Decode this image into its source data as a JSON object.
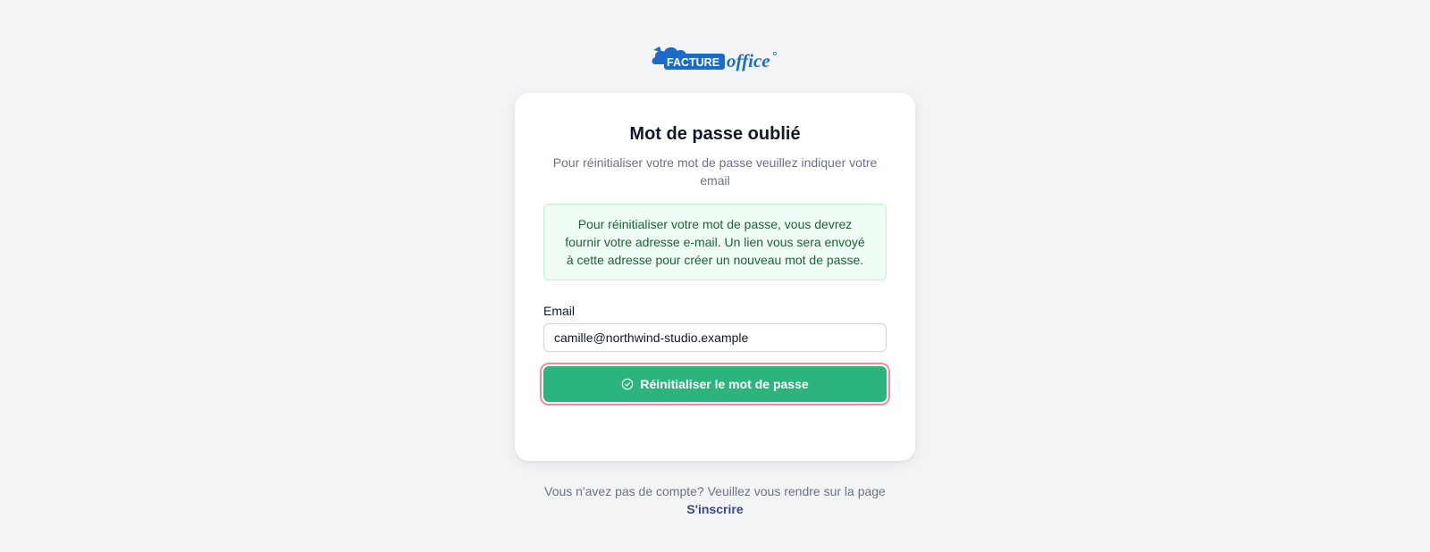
{
  "brand": {
    "logo_icon": "cloud-logo-icon",
    "wordmark_box": "FACTURE",
    "wordmark_script": "office",
    "primary_color": "#1a6cc8"
  },
  "form": {
    "title": "Mot de passe oublié",
    "subtitle": "Pour réinitialiser votre mot de passe veuillez indiquer votre email",
    "info_message": "Pour réinitialiser votre mot de passe, vous devrez fournir votre adresse e-mail. Un lien vous sera envoyé à cette adresse pour créer un nouveau mot de passe.",
    "email_label": "Email",
    "email_value": "camille@northwind-studio.example",
    "submit_label": "Réinitialiser le mot de passe",
    "submit_icon": "check-circle-icon",
    "submit_color": "#2bb57c"
  },
  "footer": {
    "prompt": "Vous n'avez pas de compte? Veuillez vous rendre sur la page",
    "signup_link": "S'inscrire"
  }
}
